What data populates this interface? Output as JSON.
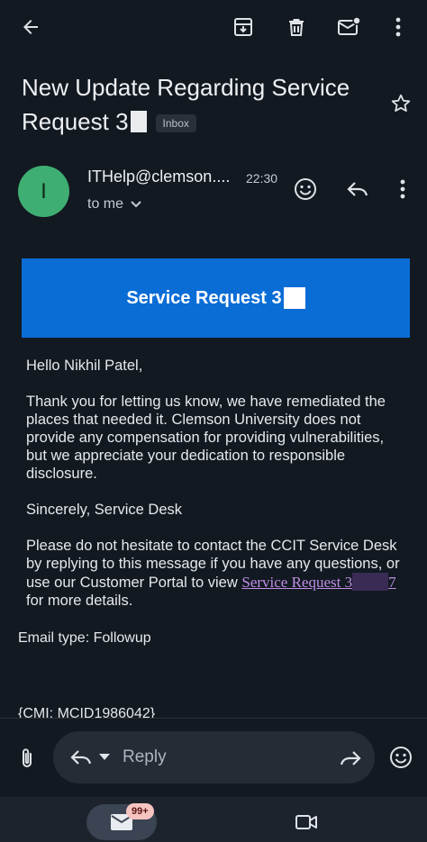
{
  "toolbar": {
    "back_icon": "arrow-left",
    "archive_icon": "archive",
    "delete_icon": "trash",
    "mark_unread_icon": "mail-dot",
    "more_icon": "dots-vertical"
  },
  "email": {
    "subject": "New Update Regarding Service Request 3",
    "label": "Inbox",
    "sender": "ITHelp@clemson....",
    "time": "22:30",
    "recipient_line": "to me",
    "avatar_letter": "I",
    "banner_title": "Service Request 3",
    "greeting": "Hello Nikhil Patel,",
    "paragraph_1": "Thank you for letting us know, we have remediated the places that needed it. Clemson University does not provide any compensation for providing vulnerabilities, but we appreciate your dedication to responsible disclosure.",
    "signature": "Sincerely, Service Desk",
    "paragraph_2_prefix": "Please do not hesitate to contact the CCIT Service Desk by replying to this message if you have any questions, or use our Customer Portal to view ",
    "portal_link_start": "Service Request 3",
    "portal_link_end": "7",
    "paragraph_2_suffix": " for more details.",
    "email_type": "Email type: Followup",
    "cmi_line": "{CMI: MCID1986042}"
  },
  "reply": {
    "placeholder": "Reply"
  },
  "bottom_nav": {
    "mail_badge": "99+"
  },
  "colors": {
    "background": "#121921",
    "banner": "#0a6dd6",
    "avatar": "#3fae72",
    "link": "#c08ee8"
  }
}
